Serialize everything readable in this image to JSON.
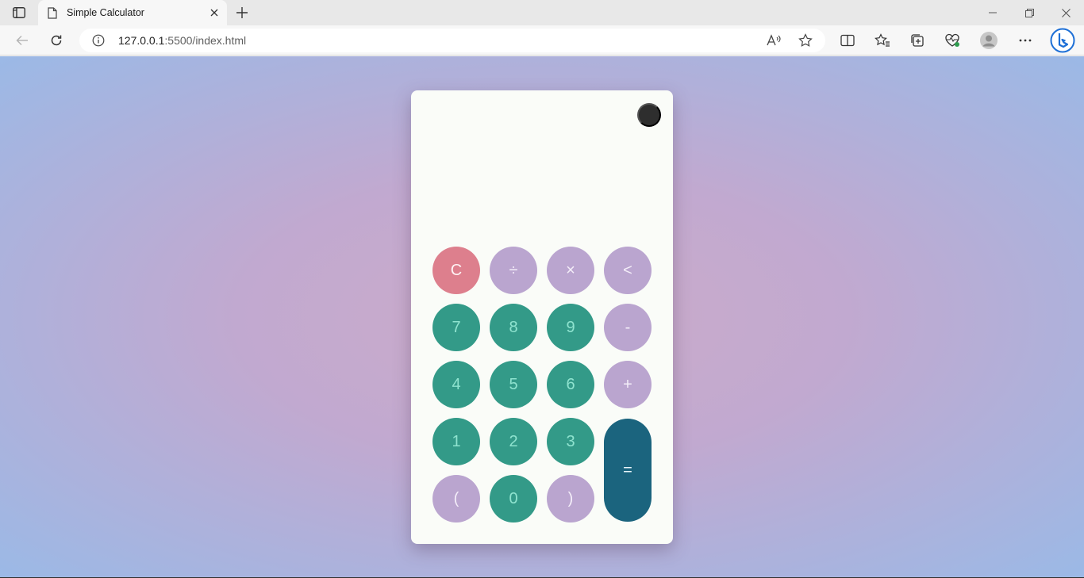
{
  "browser": {
    "tab_title": "Simple Calculator",
    "address": {
      "host": "127.0.0.1",
      "rest": ":5500/index.html"
    },
    "icons": {
      "sidebar": "sidebar-toggle-icon",
      "page": "page-icon",
      "close_tab": "close-icon",
      "new_tab": "plus-icon",
      "back": "back-arrow-icon",
      "refresh": "refresh-icon",
      "info": "info-icon",
      "read_aloud": "read-aloud-icon",
      "favorite": "star-icon",
      "split_screen": "split-screen-icon",
      "favorites": "favorites-icon",
      "collections": "collections-icon",
      "browser_essentials": "heart-pulse-icon",
      "profile": "avatar-icon",
      "more": "more-icon",
      "copilot": "bing-icon"
    }
  },
  "calculator": {
    "display": "",
    "keys": {
      "clear": "C",
      "divide": "÷",
      "multiply": "×",
      "backspace": "<",
      "seven": "7",
      "eight": "8",
      "nine": "9",
      "minus": "-",
      "four": "4",
      "five": "5",
      "six": "6",
      "plus": "+",
      "one": "1",
      "two": "2",
      "three": "3",
      "equals": "=",
      "open_paren": "(",
      "zero": "0",
      "close_paren": ")"
    },
    "colors": {
      "number_key": "#339a88",
      "operator_key": "#baa5cf",
      "clear_key": "#dd7f8d",
      "equals_key": "#1b647e",
      "theme_toggle": "#2e2e2e",
      "card": "#fafcf8"
    }
  }
}
